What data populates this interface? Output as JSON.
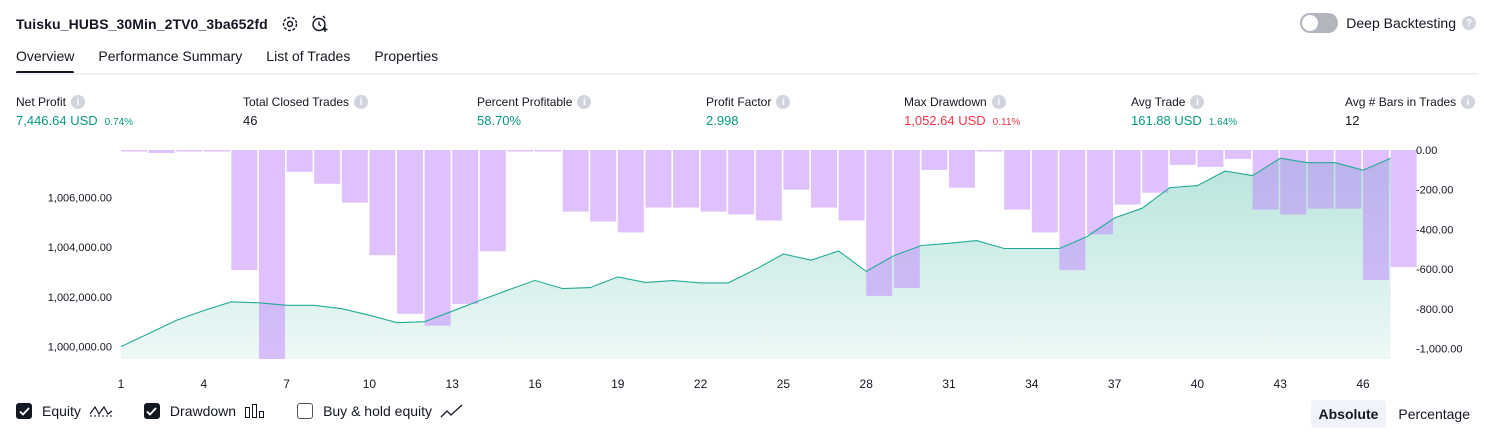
{
  "header": {
    "title": "Tuisku_HUBS_30Min_2TV0_3ba652fd",
    "deep_backtesting_label": "Deep Backtesting",
    "deep_backtesting_enabled": false
  },
  "tabs": [
    {
      "label": "Overview",
      "active": true
    },
    {
      "label": "Performance Summary",
      "active": false
    },
    {
      "label": "List of Trades",
      "active": false
    },
    {
      "label": "Properties",
      "active": false
    }
  ],
  "metrics": {
    "net_profit": {
      "label": "Net Profit",
      "value": "7,446.64 USD",
      "pct": "0.74%"
    },
    "total_closed_trades": {
      "label": "Total Closed Trades",
      "value": "46"
    },
    "percent_profitable": {
      "label": "Percent Profitable",
      "value": "58.70%"
    },
    "profit_factor": {
      "label": "Profit Factor",
      "value": "2.998"
    },
    "max_drawdown": {
      "label": "Max Drawdown",
      "value": "1,052.64 USD",
      "pct": "0.11%"
    },
    "avg_trade": {
      "label": "Avg Trade",
      "value": "161.88 USD",
      "pct": "1.64%"
    },
    "avg_bars_in_trades": {
      "label": "Avg # Bars in Trades",
      "value": "12"
    }
  },
  "colors": {
    "profit_green": "#089981",
    "loss_red": "#f23645",
    "drawdown_bar": "#d8b4fe",
    "equity_line": "#22ab94",
    "text": "#131722"
  },
  "chart_data": {
    "type": "area",
    "x_ticks": [
      "1",
      "4",
      "7",
      "10",
      "13",
      "16",
      "19",
      "22",
      "25",
      "28",
      "31",
      "34",
      "37",
      "40",
      "43",
      "46"
    ],
    "left_axis_ticks": [
      "1,000,000.00",
      "1,002,000.00",
      "1,004,000.00",
      "1,006,000.00"
    ],
    "right_axis_ticks": [
      "0.00",
      "-200.00",
      "-400.00",
      "-600.00",
      "-800.00",
      "-1,000.00"
    ],
    "ylim_left": [
      999500,
      1007900
    ],
    "ylim_right": [
      -1052.64,
      0
    ],
    "series": [
      {
        "name": "Equity",
        "type": "area",
        "x": [
          1,
          2,
          3,
          4,
          5,
          6,
          7,
          8,
          9,
          10,
          11,
          12,
          13,
          14,
          15,
          16,
          17,
          18,
          19,
          20,
          21,
          22,
          23,
          24,
          25,
          26,
          27,
          28,
          29,
          30,
          31,
          32,
          33,
          34,
          35,
          36,
          37,
          38,
          39,
          40,
          41,
          42,
          43,
          44,
          45,
          46,
          47
        ],
        "values": [
          1000000,
          1000520,
          1001050,
          1001450,
          1001800,
          1001760,
          1001660,
          1001660,
          1001520,
          1001260,
          1000960,
          1001000,
          1001420,
          1001850,
          1002260,
          1002660,
          1002330,
          1002370,
          1002800,
          1002580,
          1002650,
          1002560,
          1002560,
          1003110,
          1003720,
          1003470,
          1003840,
          1003020,
          1003650,
          1004060,
          1004150,
          1004260,
          1003940,
          1003940,
          1003940,
          1004420,
          1005170,
          1005560,
          1006390,
          1006470,
          1007050,
          1006870,
          1007570,
          1007390,
          1007390,
          1007090,
          1007570
        ]
      },
      {
        "name": "Drawdown",
        "type": "bar",
        "x": [
          1,
          2,
          3,
          4,
          5,
          6,
          7,
          8,
          9,
          10,
          11,
          12,
          13,
          14,
          15,
          16,
          17,
          18,
          19,
          20,
          21,
          22,
          23,
          24,
          25,
          26,
          27,
          28,
          29,
          30,
          31,
          32,
          33,
          34,
          35,
          36,
          37,
          38,
          39,
          40,
          41,
          42,
          43,
          44,
          45,
          46,
          47
        ],
        "values": [
          -5,
          -15,
          -5,
          -5,
          -605,
          -1052.64,
          -110,
          -170,
          -265,
          -530,
          -825,
          -885,
          -775,
          -510,
          -5,
          -5,
          -310,
          -360,
          -415,
          -290,
          -290,
          -310,
          -325,
          -355,
          -200,
          -290,
          -355,
          -735,
          -695,
          -100,
          -190,
          -5,
          -300,
          -415,
          -605,
          -425,
          -275,
          -215,
          -75,
          -85,
          -45,
          -300,
          -325,
          -295,
          -295,
          -655,
          -590
        ]
      }
    ],
    "legend": [
      {
        "name": "Equity",
        "checked": true
      },
      {
        "name": "Drawdown",
        "checked": true
      },
      {
        "name": "Buy & hold equity",
        "checked": false
      }
    ],
    "modes": [
      {
        "label": "Absolute",
        "active": true
      },
      {
        "label": "Percentage",
        "active": false
      }
    ]
  }
}
